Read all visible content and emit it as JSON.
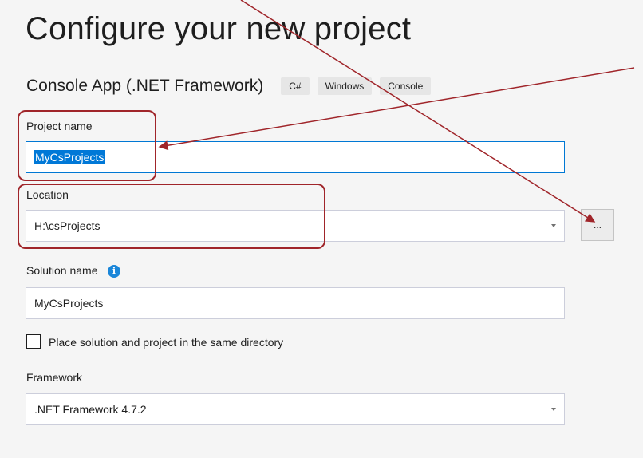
{
  "page": {
    "title": "Configure your new project",
    "template_name": "Console App (.NET Framework)",
    "tags": [
      "C#",
      "Windows",
      "Console"
    ]
  },
  "project_name": {
    "label": "Project name",
    "value": "MyCsProjects"
  },
  "location": {
    "label": "Location",
    "value": "H:\\csProjects",
    "browse_label": "..."
  },
  "solution_name": {
    "label": "Solution name",
    "info_icon": "i",
    "value": "MyCsProjects"
  },
  "same_directory": {
    "label": "Place solution and project in the same directory",
    "checked": false
  },
  "framework": {
    "label": "Framework",
    "value": ".NET Framework 4.7.2"
  },
  "colors": {
    "accent": "#0078d4",
    "annotation": "#a0252a",
    "info": "#1a86d9"
  }
}
